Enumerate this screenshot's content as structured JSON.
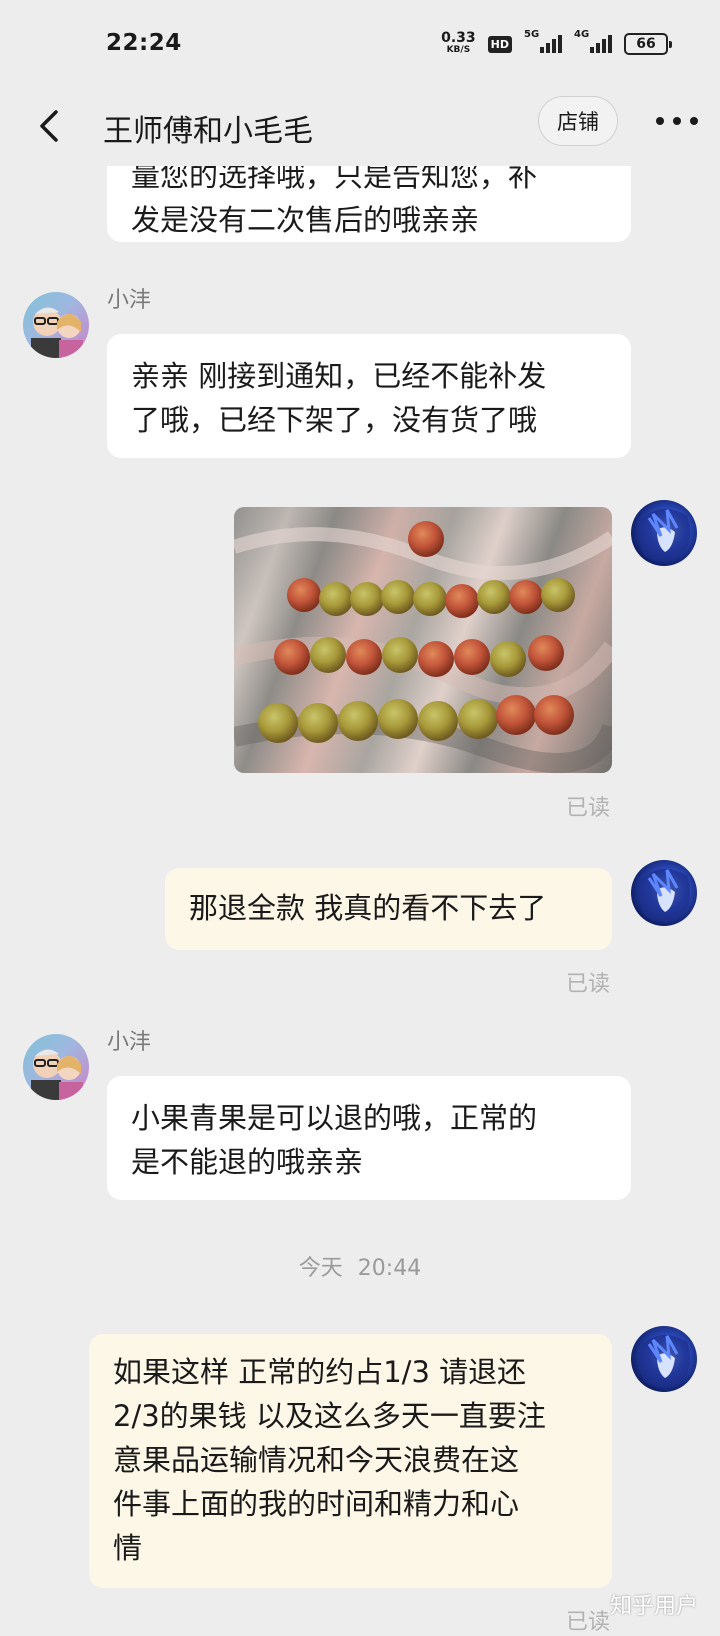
{
  "status_bar": {
    "time": "22:24",
    "net_speed_value": "0.33",
    "net_speed_unit": "KB/S",
    "hd_label": "HD",
    "signal1_label": "5G",
    "signal2_label": "4G",
    "battery": "66"
  },
  "nav": {
    "title": "王师傅和小毛毛",
    "shop_button": "店铺",
    "back_icon": "chevron-left-icon",
    "more_icon": "more-dots-icon"
  },
  "messages": {
    "m1_line1": "量您的选择哦，只是告知您，补",
    "m1_line2": "发是没有二次售后的哦亲亲",
    "m2_sender": "小沣",
    "m2_line1": "亲亲 刚接到通知，已经不能补发",
    "m2_line2": "了哦，已经下架了，没有货了哦",
    "m3_read": "已读",
    "m4_text": "那退全款  我真的看不下去了",
    "m4_read": "已读",
    "m5_sender": "小沣",
    "m5_line1": "小果青果是可以退的哦，正常的",
    "m5_line2": "是不能退的哦亲亲",
    "time_sep_day": "今天",
    "time_sep_time": "20:44",
    "m6_line1": "如果这样 正常的约占1/3  请退还",
    "m6_line2": "2/3的果钱 以及这么多天一直要注",
    "m6_line3": "意果品运输情况和今天浪费在这",
    "m6_line4": "件事上面的我的时间和精力和心",
    "m6_line5": "情",
    "m6_read": "已读"
  },
  "watermark": "知乎用户",
  "colors": {
    "background": "#ededed",
    "incoming_bubble": "#ffffff",
    "outgoing_bubble": "#fdf7e7",
    "read_tag": "#b2b2b2"
  }
}
